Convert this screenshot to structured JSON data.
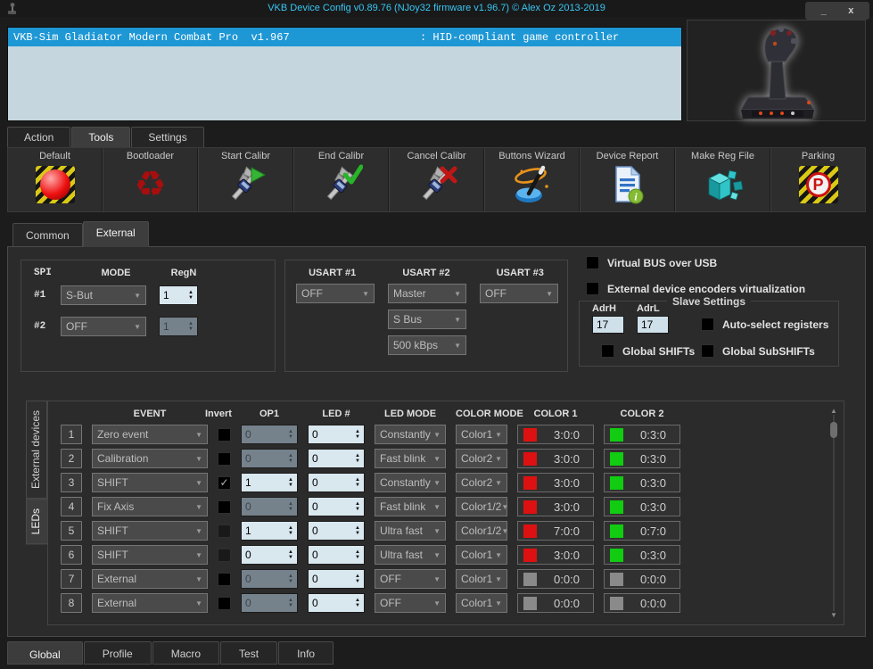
{
  "titlebar": {
    "title": "VKB Device Config v0.89.76 (NJoy32 firmware v1.96.7) © Alex Oz 2013-2019",
    "minimize": "_",
    "close": "x"
  },
  "device_list": {
    "selected_name": "VKB-Sim Gladiator Modern Combat Pro  v1.967",
    "selected_type": ": HID-compliant game controller"
  },
  "menu_tabs": {
    "action": "Action",
    "tools": "Tools",
    "settings": "Settings"
  },
  "toolbar": {
    "buttons": [
      {
        "label": "Default",
        "icon": "default-icon"
      },
      {
        "label": "Bootloader",
        "icon": "bootloader-icon"
      },
      {
        "label": "Start Calibr",
        "icon": "start-calibr-icon"
      },
      {
        "label": "End Calibr",
        "icon": "end-calibr-icon"
      },
      {
        "label": "Cancel Calibr",
        "icon": "cancel-calibr-icon"
      },
      {
        "label": "Buttons Wizard",
        "icon": "buttons-wizard-icon"
      },
      {
        "label": "Device Report",
        "icon": "device-report-icon"
      },
      {
        "label": "Make Reg File",
        "icon": "make-reg-file-icon"
      },
      {
        "label": "Parking",
        "icon": "parking-icon"
      }
    ]
  },
  "page_tabs": {
    "common": "Common",
    "external": "External"
  },
  "spi": {
    "title_label": "SPI",
    "mode_header": "MODE",
    "regn_header": "RegN",
    "rows": [
      {
        "id": "#1",
        "mode": "S-But",
        "regn": "1",
        "enabled": true
      },
      {
        "id": "#2",
        "mode": "OFF",
        "regn": "1",
        "enabled": false
      }
    ]
  },
  "usart": {
    "h1": "USART #1",
    "h2": "USART #2",
    "h3": "USART #3",
    "u1": "OFF",
    "u2_mode": "Master",
    "u2_proto": "S Bus",
    "u2_speed": "500 kBps",
    "u3": "OFF"
  },
  "options": {
    "virtual_bus": "Virtual BUS over USB",
    "ext_encoders": "External device encoders virtualization"
  },
  "slave": {
    "title": "Slave Settings",
    "adrh_label": "AdrH",
    "adrl_label": "AdrL",
    "adrh_value": "17",
    "adrl_value": "17",
    "auto_select": "Auto-select registers",
    "global_shifts": "Global SHIFTs",
    "global_subshifts": "Global SubSHIFTs"
  },
  "side_tabs": {
    "external_devices": "External devices",
    "leds": "LEDs"
  },
  "led_table": {
    "headers": {
      "event": "EVENT",
      "invert": "Invert",
      "op1": "OP1",
      "led": "LED #",
      "led_mode": "LED MODE",
      "color_mode": "COLOR MODE",
      "color1": "COLOR 1",
      "color2": "COLOR 2"
    },
    "check_glyph": "✓",
    "colors": {
      "red": "#dd1111",
      "green": "#11cc11",
      "gray": "#8a8a8a"
    },
    "rows": [
      {
        "num": "1",
        "event": "Zero event",
        "invert": "off",
        "op1": "0",
        "op1_enabled": false,
        "led": "0",
        "led_mode": "Constantly",
        "color_mode": "Color1",
        "color1": {
          "swatch": "#dd1111",
          "value": "3:0:0"
        },
        "color2": {
          "swatch": "#11cc11",
          "value": "0:3:0"
        }
      },
      {
        "num": "2",
        "event": "Calibration",
        "invert": "off",
        "op1": "0",
        "op1_enabled": false,
        "led": "0",
        "led_mode": "Fast blink",
        "color_mode": "Color2",
        "color1": {
          "swatch": "#dd1111",
          "value": "3:0:0"
        },
        "color2": {
          "swatch": "#11cc11",
          "value": "0:3:0"
        }
      },
      {
        "num": "3",
        "event": "SHIFT",
        "invert": "on",
        "op1": "1",
        "op1_enabled": true,
        "led": "0",
        "led_mode": "Constantly",
        "color_mode": "Color2",
        "color1": {
          "swatch": "#dd1111",
          "value": "3:0:0"
        },
        "color2": {
          "swatch": "#11cc11",
          "value": "0:3:0"
        }
      },
      {
        "num": "4",
        "event": "Fix Axis",
        "invert": "off",
        "op1": "0",
        "op1_enabled": false,
        "led": "0",
        "led_mode": "Fast blink",
        "color_mode": "Color1/2",
        "color1": {
          "swatch": "#dd1111",
          "value": "3:0:0"
        },
        "color2": {
          "swatch": "#11cc11",
          "value": "0:3:0"
        }
      },
      {
        "num": "5",
        "event": "SHIFT",
        "invert": "dim",
        "op1": "1",
        "op1_enabled": true,
        "led": "0",
        "led_mode": "Ultra fast",
        "color_mode": "Color1/2",
        "color1": {
          "swatch": "#dd1111",
          "value": "7:0:0"
        },
        "color2": {
          "swatch": "#11cc11",
          "value": "0:7:0"
        }
      },
      {
        "num": "6",
        "event": "SHIFT",
        "invert": "dim",
        "op1": "0",
        "op1_enabled": true,
        "led": "0",
        "led_mode": "Ultra fast",
        "color_mode": "Color1",
        "color1": {
          "swatch": "#dd1111",
          "value": "3:0:0"
        },
        "color2": {
          "swatch": "#11cc11",
          "value": "0:3:0"
        }
      },
      {
        "num": "7",
        "event": "External",
        "invert": "off",
        "op1": "0",
        "op1_enabled": false,
        "led": "0",
        "led_mode": "OFF",
        "color_mode": "Color1",
        "color1": {
          "swatch": "#8a8a8a",
          "value": "0:0:0"
        },
        "color2": {
          "swatch": "#8a8a8a",
          "value": "0:0:0"
        }
      },
      {
        "num": "8",
        "event": "External",
        "invert": "off",
        "op1": "0",
        "op1_enabled": false,
        "led": "0",
        "led_mode": "OFF",
        "color_mode": "Color1",
        "color1": {
          "swatch": "#8a8a8a",
          "value": "0:0:0"
        },
        "color2": {
          "swatch": "#8a8a8a",
          "value": "0:0:0"
        }
      }
    ]
  },
  "bottom_tabs": {
    "global": "Global",
    "profile": "Profile",
    "macro": "Macro",
    "test": "Test",
    "info": "Info"
  }
}
